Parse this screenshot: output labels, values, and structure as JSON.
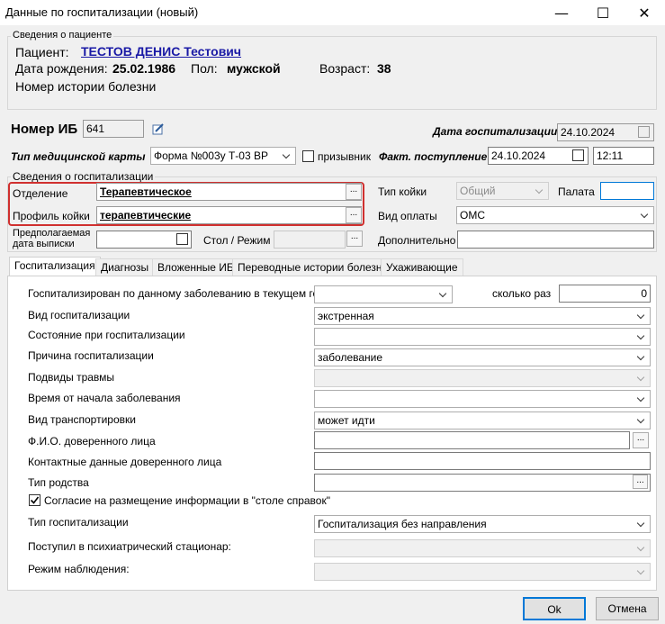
{
  "window": {
    "title": "Данные по госпитализации (новый)",
    "minimize_icon": "minimize-icon",
    "maximize_icon": "maximize-icon",
    "close_icon": "close-icon"
  },
  "patient": {
    "group_label": "Сведения о пациенте",
    "patient_label": "Пациент:",
    "patient_name": "ТЕСТОВ ДЕНИС Тестович",
    "dob_label": "Дата рождения:",
    "dob_value": "25.02.1986",
    "sex_label": "Пол:",
    "sex_value": "мужской",
    "age_label": "Возраст:",
    "age_value": "38",
    "history_label": "Номер истории болезни"
  },
  "header_fields": {
    "ib_label": "Номер ИБ",
    "ib_value": "641",
    "hosp_date_label": "Дата госпитализации",
    "hosp_date_value": "24.10.2024",
    "card_type_label": "Тип медицинской карты",
    "card_type_value": "Форма №003у Т-03 ВР",
    "conscript_label": "призывник",
    "fact_label": "Факт. поступление",
    "fact_date": "24.10.2024",
    "fact_time": "12:11"
  },
  "hosp_info": {
    "group_label": "Сведения о госпитализации",
    "dept_label": "Отделение",
    "dept_value": "Терапевтическое",
    "bed_profile_label": "Профиль койки",
    "bed_profile_value": "терапевтические",
    "discharge_label_1": "Предполагаемая",
    "discharge_label_2": "дата выписки",
    "bed_type_label": "Тип койки",
    "bed_type_value": "Общий",
    "ward_label": "Палата",
    "ward_value": "",
    "payment_label": "Вид оплаты",
    "payment_value": "ОМС",
    "table_label": "Стол / Режим",
    "additional_label": "Дополнительно",
    "dots": "..."
  },
  "tabs": [
    "Госпитализация",
    "Диагнозы",
    "Вложенные ИБ",
    "Переводные истории болезни",
    "Ухаживающие"
  ],
  "form": {
    "r1_label": "Госпитализирован по данному заболеванию в текущем году",
    "times_label": "сколько раз",
    "times_value": "0",
    "r2_label": "Вид госпитализации",
    "r2_value": "экстренная",
    "r3_label": "Состояние при госпитализации",
    "r4_label": "Причина госпитализации",
    "r4_value": "заболевание",
    "r5_label": "Подвиды травмы",
    "r6_label": "Время от начала заболевания",
    "r7_label": "Вид транспортировки",
    "r7_value": "может идти",
    "r8_label": "Ф.И.О. доверенного лица",
    "r9_label": "Контактные данные доверенного лица",
    "r10_label": "Тип родства",
    "consent_label": "Согласие на размещение информации в \"столе справок\"",
    "r11_label": "Тип госпитализации",
    "r11_value": "Госпитализация без направления",
    "r12_label": "Поступил в психиатрический стационар:",
    "r13_label": "Режим наблюдения:"
  },
  "buttons": {
    "ok": "Ok",
    "cancel": "Отмена"
  },
  "colors": {
    "highlight": "#d0302f",
    "link": "#1a1aa6"
  }
}
